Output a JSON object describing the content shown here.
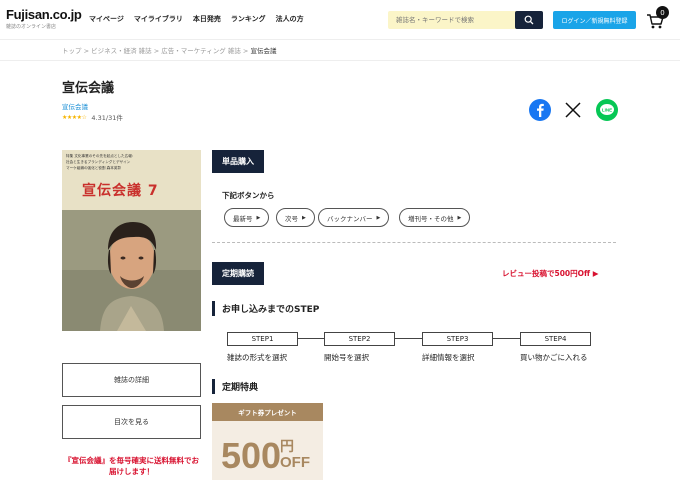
{
  "header": {
    "logo": "Fujisan.co.jp",
    "logo_sub": "雑誌のオンライン書店",
    "nav": [
      "マイページ",
      "マイライブラリ",
      "本日発売",
      "ランキング",
      "法人の方"
    ],
    "search_placeholder": "雑誌名・キーワードで検索",
    "login_label": "ログイン／新規無料登録",
    "cart_count": "0"
  },
  "breadcrumb": {
    "items": [
      "トップ",
      "ビジネス・経済 雑誌",
      "広告・マーケティング 雑誌"
    ],
    "separator": ">",
    "current": "宣伝会議"
  },
  "product": {
    "title": "宣伝会議",
    "publisher": "宣伝会議",
    "rating_stars": "★★★★☆",
    "rating_text": "4.31/31件",
    "rating_value": 4.31
  },
  "cover": {
    "lines": [
      "特集 文化事業のその先を起点とした広報：",
      "社会と生きるブランディングとデザイン",
      "",
      "マーケ組織の強化と役割 森本英彰"
    ],
    "title": "宣伝会議 7",
    "colors": {
      "title": "#c9302c",
      "bg": "#e8e1c6"
    }
  },
  "sidebar": {
    "details_button": "雑誌の詳細",
    "toc_button": "目次を見る",
    "note": "『宣伝会議』を毎号確実に送料無料でお届けします！"
  },
  "single_purchase": {
    "label": "単品購入",
    "subtitle": "下記ボタンから",
    "options": [
      "最新号",
      "次号",
      "バックナンバー",
      "増刊号・その他"
    ]
  },
  "subscription": {
    "label": "定期購読",
    "promo": "レビュー投稿で500円Off ▶",
    "steps_heading": "お申し込みまでのSTEP",
    "steps": [
      {
        "label": "STEP1",
        "text": "雑誌の形式を選択"
      },
      {
        "label": "STEP2",
        "text": "開始号を選択"
      },
      {
        "label": "STEP3",
        "text": "詳細情報を選択"
      },
      {
        "label": "STEP4",
        "text": "買い物かごに入れる"
      }
    ],
    "benefit_heading": "定期特典",
    "gift": {
      "head": "ギフト券プレゼント",
      "amount": "500",
      "yen": "円",
      "off": "OFF"
    }
  },
  "colors": {
    "navy": "#16233a",
    "accent_blue": "#1aa4e8",
    "red": "#d8112f",
    "gold": "#a88860"
  },
  "icons": [
    "search-icon",
    "cart-icon",
    "facebook-icon",
    "x-icon",
    "line-icon"
  ]
}
